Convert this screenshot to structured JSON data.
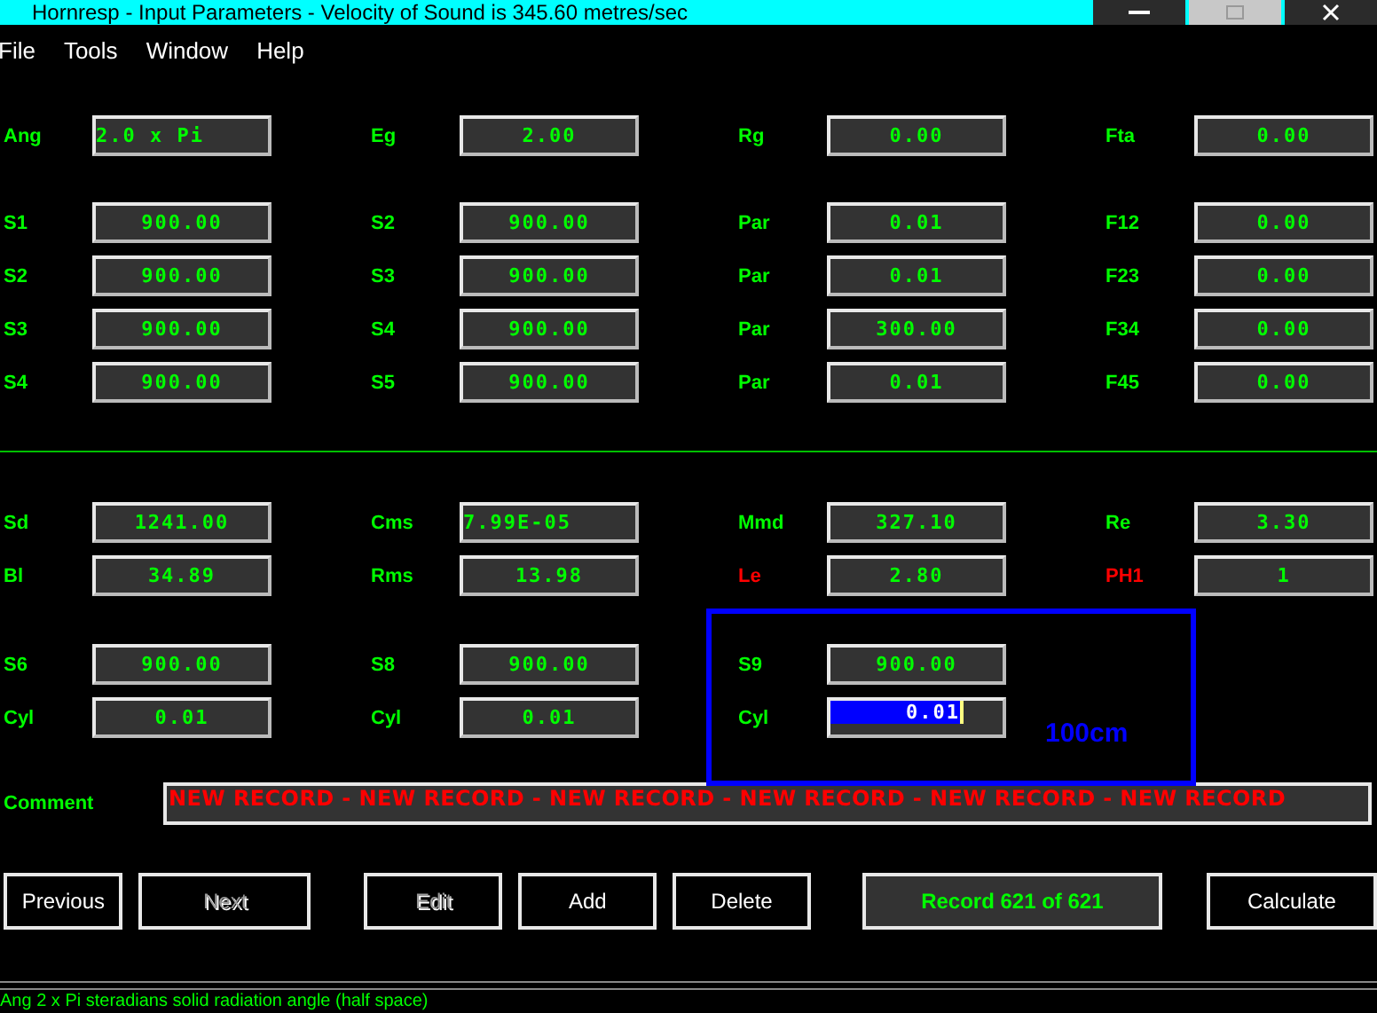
{
  "window": {
    "title": "Hornresp - Input Parameters - Velocity of Sound is 345.60 metres/sec"
  },
  "menu": [
    "File",
    "Tools",
    "Window",
    "Help"
  ],
  "groups": [
    {
      "rows": [
        [
          {
            "label": "Ang",
            "value": "2.0 x Pi",
            "color": "#00ff00",
            "selected": false
          },
          {
            "label": "Eg",
            "value": "2.00",
            "color": "#00ff00",
            "selected": false
          },
          {
            "label": "Rg",
            "value": "0.00",
            "color": "#00ff00",
            "selected": false
          },
          {
            "label": "Fta",
            "value": "0.00",
            "color": "#00ff00",
            "selected": false
          }
        ]
      ]
    },
    {
      "rows": [
        [
          {
            "label": "S1",
            "value": "900.00",
            "color": "#00ff00",
            "selected": false
          },
          {
            "label": "S2",
            "value": "900.00",
            "color": "#00ff00",
            "selected": false
          },
          {
            "label": "Par",
            "value": "0.01",
            "color": "#00ff00",
            "selected": false
          },
          {
            "label": "F12",
            "value": "0.00",
            "color": "#00ff00",
            "selected": false
          }
        ],
        [
          {
            "label": "S2",
            "value": "900.00",
            "color": "#00ff00",
            "selected": false
          },
          {
            "label": "S3",
            "value": "900.00",
            "color": "#00ff00",
            "selected": false
          },
          {
            "label": "Par",
            "value": "0.01",
            "color": "#00ff00",
            "selected": false
          },
          {
            "label": "F23",
            "value": "0.00",
            "color": "#00ff00",
            "selected": false
          }
        ],
        [
          {
            "label": "S3",
            "value": "900.00",
            "color": "#00ff00",
            "selected": false
          },
          {
            "label": "S4",
            "value": "900.00",
            "color": "#00ff00",
            "selected": false
          },
          {
            "label": "Par",
            "value": "300.00",
            "color": "#00ff00",
            "selected": false
          },
          {
            "label": "F34",
            "value": "0.00",
            "color": "#00ff00",
            "selected": false
          }
        ],
        [
          {
            "label": "S4",
            "value": "900.00",
            "color": "#00ff00",
            "selected": false
          },
          {
            "label": "S5",
            "value": "900.00",
            "color": "#00ff00",
            "selected": false
          },
          {
            "label": "Par",
            "value": "0.01",
            "color": "#00ff00",
            "selected": false
          },
          {
            "label": "F45",
            "value": "0.00",
            "color": "#00ff00",
            "selected": false
          }
        ]
      ]
    },
    {
      "divider": true,
      "rows": [
        [
          {
            "label": "Sd",
            "value": "1241.00",
            "color": "#00ff00",
            "selected": false
          },
          {
            "label": "Cms",
            "value": "7.99E-05",
            "color": "#00ff00",
            "selected": false
          },
          {
            "label": "Mmd",
            "value": "327.10",
            "color": "#00ff00",
            "selected": false
          },
          {
            "label": "Re",
            "value": "3.30",
            "color": "#00ff00",
            "selected": false
          }
        ],
        [
          {
            "label": "Bl",
            "value": "34.89",
            "color": "#00ff00",
            "selected": false
          },
          {
            "label": "Rms",
            "value": "13.98",
            "color": "#00ff00",
            "selected": false
          },
          {
            "label": "Le",
            "value": "2.80",
            "color": "#ff0000",
            "selected": false
          },
          {
            "label": "PH1",
            "value": "1",
            "color": "#ff0000",
            "selected": false
          }
        ]
      ]
    },
    {
      "rows": [
        [
          {
            "label": "S6",
            "value": "900.00",
            "color": "#00ff00",
            "selected": false
          },
          {
            "label": "S8",
            "value": "900.00",
            "color": "#00ff00",
            "selected": false
          },
          {
            "label": "S9",
            "value": "900.00",
            "color": "#00ff00",
            "selected": false
          }
        ],
        [
          {
            "label": "Cyl",
            "value": "0.01",
            "color": "#00ff00",
            "selected": false
          },
          {
            "label": "Cyl",
            "value": "0.01",
            "color": "#00ff00",
            "selected": false
          },
          {
            "label": "Cyl",
            "value": "0.01",
            "color": "#00ff00",
            "selected": true
          }
        ]
      ]
    }
  ],
  "annotation": {
    "text": "100cm"
  },
  "comment": {
    "label": "Comment",
    "value": "NEW RECORD - NEW RECORD - NEW RECORD - NEW RECORD - NEW RECORD - NEW RECORD"
  },
  "buttons": [
    {
      "label": "Previous",
      "disabled": false
    },
    {
      "label": "Next",
      "disabled": true
    },
    {
      "label": "Edit",
      "disabled": true
    },
    {
      "label": "Add",
      "disabled": false
    },
    {
      "label": "Delete",
      "disabled": false
    }
  ],
  "record": "Record 621 of 621",
  "calculate": "Calculate",
  "status_bar": "Ang  2 x Pi steradians solid radiation angle  (half space)"
}
